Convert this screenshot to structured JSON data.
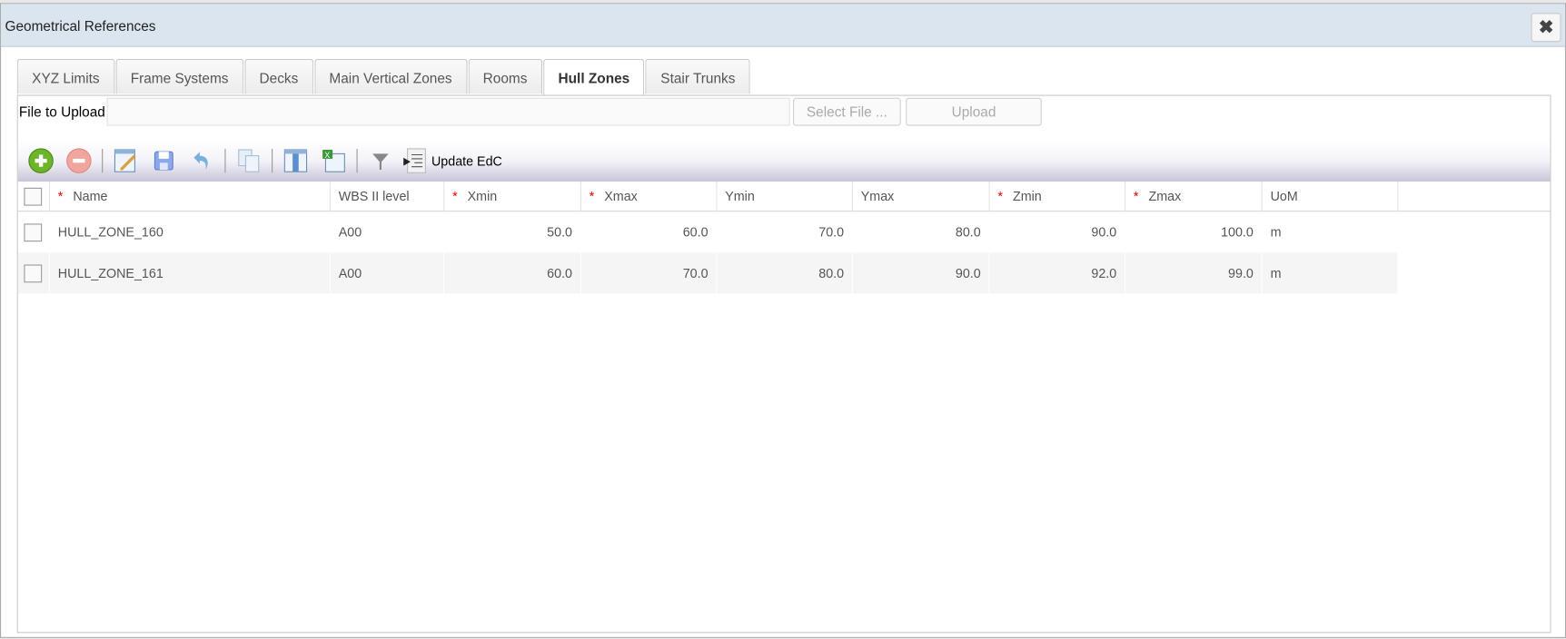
{
  "dialog": {
    "title": "Geometrical References",
    "close_icon": "close-icon"
  },
  "tabs": [
    {
      "label": "XYZ Limits"
    },
    {
      "label": "Frame Systems"
    },
    {
      "label": "Decks"
    },
    {
      "label": "Main Vertical Zones"
    },
    {
      "label": "Rooms"
    },
    {
      "label": "Hull Zones",
      "active": true
    },
    {
      "label": "Stair Trunks"
    }
  ],
  "upload": {
    "label": "File to Upload",
    "value": "",
    "select_label": "Select File ...",
    "upload_label": "Upload"
  },
  "toolbar": {
    "update_label": "Update EdC"
  },
  "grid": {
    "columns": [
      {
        "label": "Name",
        "required": "*"
      },
      {
        "label": "WBS II level"
      },
      {
        "label": "Xmin",
        "required": "*"
      },
      {
        "label": "Xmax",
        "required": "*"
      },
      {
        "label": "Ymin"
      },
      {
        "label": "Ymax"
      },
      {
        "label": "Zmin",
        "required": "*"
      },
      {
        "label": "Zmax",
        "required": "*"
      },
      {
        "label": "UoM"
      }
    ],
    "rows": [
      {
        "name": "HULL_ZONE_160",
        "wbs": "A00",
        "xmin": "50.0",
        "xmax": "60.0",
        "ymin": "70.0",
        "ymax": "80.0",
        "zmin": "90.0",
        "zmax": "100.0",
        "uom": "m"
      },
      {
        "name": "HULL_ZONE_161",
        "wbs": "A00",
        "xmin": "60.0",
        "xmax": "70.0",
        "ymin": "80.0",
        "ymax": "90.0",
        "zmin": "92.0",
        "zmax": "99.0",
        "uom": "m"
      }
    ]
  }
}
